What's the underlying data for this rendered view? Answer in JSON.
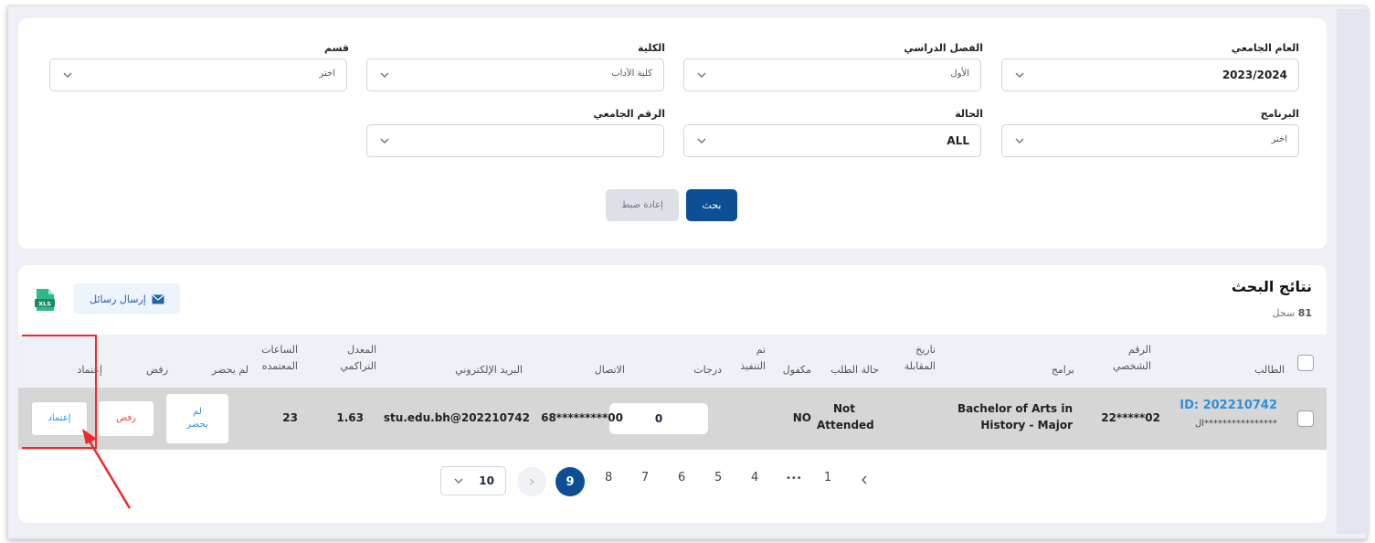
{
  "filters": {
    "academic_year": {
      "label": "العام الجامعي",
      "value": "2023/2024"
    },
    "semester": {
      "label": "الفصل الدراسي",
      "value": "الأول"
    },
    "college": {
      "label": "الكلية",
      "value": "كلية الآداب"
    },
    "department": {
      "label": "قسم",
      "value": "اختر"
    },
    "program": {
      "label": "البرنامج",
      "value": "اختر"
    },
    "status": {
      "label": "الحالة",
      "value": "ALL"
    },
    "university_id": {
      "label": "الرقم الجامعي",
      "value": ""
    },
    "search_label": "بحث",
    "reset_label": "إعادة ضبط"
  },
  "results": {
    "title": "نتائج البحث",
    "count": "81",
    "count_unit": "سجل",
    "send_messages_label": "إرسال رسائل",
    "export_icon": "xls-icon",
    "columns": {
      "student": "الطالب",
      "personal_id": "الرقم الشخصي",
      "programs": "برامج",
      "interview_date": "تاريخ المقابلة",
      "request_status": "حالة الطلب",
      "sponsored": "مكفول",
      "executed": "تم التنفيذ",
      "grades": "درجات",
      "contact": "الاتصال",
      "email": "البريد الإلكتروني",
      "gpa": "المعدل التراكمي",
      "credit_hours": "الساعات المعتمده",
      "absent": "لم يحضر",
      "reject": "رفض",
      "approve": "إعتماد"
    },
    "rows": [
      {
        "student_id": "ID: 202210742",
        "student_name": "ال****************",
        "personal_id": "22*****02",
        "program": "Bachelor of Arts in History - Major",
        "interview_date": "",
        "request_status": "Not Attended",
        "sponsored": "NO",
        "executed": "",
        "grade": "0",
        "contact": "68*********00",
        "email": "stu.edu.bh@202210742",
        "gpa": "1.63",
        "credit_hours": "23",
        "absent_label": "لم يحضر",
        "reject_label": "رفض",
        "approve_label": "إعتماد"
      }
    ]
  },
  "pagination": {
    "page_size": "10",
    "pages": [
      "9",
      "8",
      "7",
      "6",
      "5",
      "4",
      "1"
    ],
    "ellipsis": "•••",
    "active": "9"
  },
  "colors": {
    "primary": "#0d4f95",
    "link": "#2f8fd8",
    "reject": "#e5484d",
    "highlight": "#ee2a2a"
  }
}
